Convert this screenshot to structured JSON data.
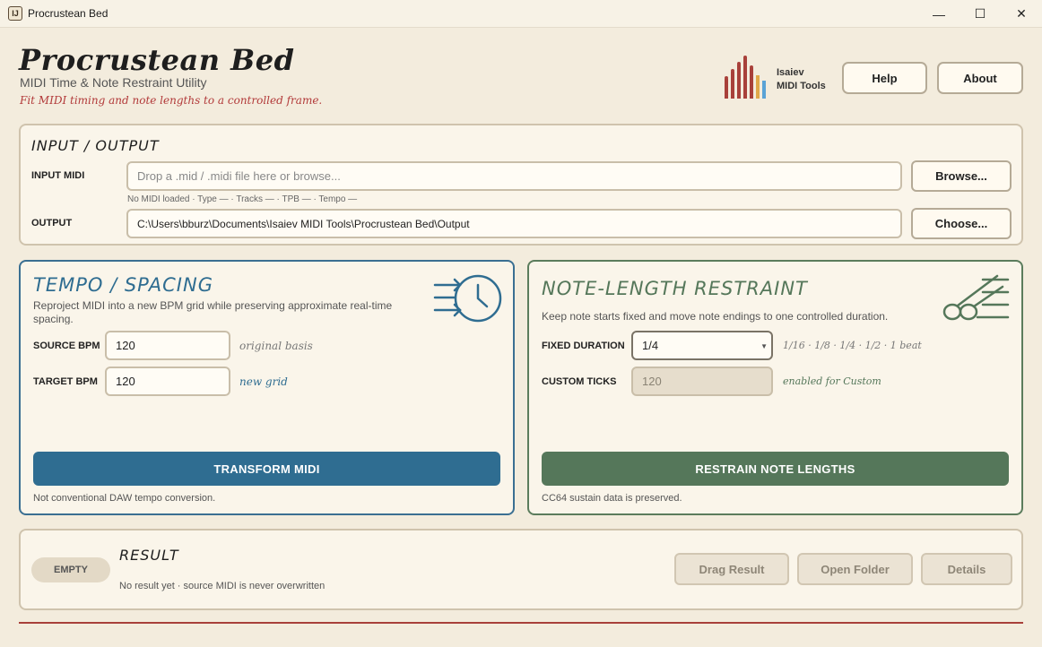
{
  "window": {
    "title": "Procrustean Bed",
    "app_icon_glyph": "IJ",
    "controls": {
      "minimize": "—",
      "maximize": "☐",
      "close": "✕"
    }
  },
  "header": {
    "title": "Procrustean Bed",
    "subtitle": "MIDI Time & Note Restraint Utility",
    "tagline": "Fit MIDI timing and note lengths to a controlled frame.",
    "brand_line1": "Isaiev",
    "brand_line2": "MIDI Tools",
    "help_label": "Help",
    "about_label": "About"
  },
  "io": {
    "title": "INPUT / OUTPUT",
    "input_label": "INPUT MIDI",
    "input_placeholder": "Drop a .mid / .midi file here or browse...",
    "browse_label": "Browse...",
    "meta": "No MIDI loaded  ·  Type —  ·  Tracks —  ·  TPB —  ·  Tempo —",
    "output_label": "OUTPUT",
    "output_value": "C:\\Users\\bburz\\Documents\\Isaiev MIDI Tools\\Procrustean Bed\\Output",
    "choose_label": "Choose..."
  },
  "tempo": {
    "title": "TEMPO / SPACING",
    "description": "Reproject MIDI into a new BPM grid while preserving approximate real-time spacing.",
    "source_label": "SOURCE BPM",
    "source_value": "120",
    "source_hint": "original basis",
    "target_label": "TARGET BPM",
    "target_value": "120",
    "target_hint": "new grid",
    "action_label": "TRANSFORM MIDI",
    "footnote": "Not conventional DAW tempo conversion.",
    "icon": "tempo-clock-icon",
    "accent": "#2f6d91"
  },
  "note": {
    "title": "NOTE-LENGTH RESTRAINT",
    "description": "Keep note starts fixed and move note endings to one controlled duration.",
    "duration_label": "FIXED DURATION",
    "duration_value": "1/4",
    "duration_hint": "1/16 · 1/8 · 1/4 · 1/2 · 1 beat",
    "ticks_label": "CUSTOM TICKS",
    "ticks_value": "120",
    "ticks_hint": "enabled for Custom",
    "action_label": "RESTRAIN NOTE LENGTHS",
    "footnote": "CC64 sustain data is preserved.",
    "icon": "note-restraint-icon",
    "accent": "#55775a"
  },
  "result": {
    "badge": "EMPTY",
    "title": "RESULT",
    "status": "No result yet · source MIDI is never overwritten",
    "drag_label": "Drag Result",
    "folder_label": "Open Folder",
    "details_label": "Details"
  },
  "colors": {
    "background": "#f3ecdd",
    "tagline": "#b23a3a",
    "divider": "#a8403a"
  }
}
